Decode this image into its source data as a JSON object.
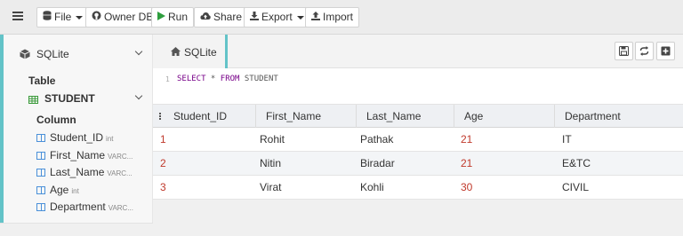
{
  "toolbar": {
    "buttons": [
      {
        "label": "File",
        "icon": "database-icon"
      },
      {
        "label": "Owner DB",
        "icon": "github-icon"
      },
      {
        "label": "Run",
        "icon": "play-icon"
      },
      {
        "label": "Share",
        "icon": "cloud-upload-icon"
      },
      {
        "label": "Export",
        "icon": "download-icon"
      },
      {
        "label": "Import",
        "icon": "upload-icon"
      }
    ],
    "accent_color": "#63c3c8",
    "run_color": "#2e9e3e"
  },
  "sidebar": {
    "db_label": "SQLite",
    "table_heading": "Table",
    "table_name": "STUDENT",
    "column_heading": "Column",
    "columns": [
      {
        "name": "Student_ID",
        "type": "int"
      },
      {
        "name": "First_Name",
        "type": "VARC..."
      },
      {
        "name": "Last_Name",
        "type": "VARC..."
      },
      {
        "name": "Age",
        "type": "int"
      },
      {
        "name": "Department",
        "type": "VARC..."
      }
    ]
  },
  "tab": {
    "label": "SQLite"
  },
  "editor": {
    "line_number": "1",
    "kw1": "SELECT",
    "star": " * ",
    "kw2": "FROM",
    "table": " STUDENT"
  },
  "results": {
    "headers": [
      "Student_ID",
      "First_Name",
      "Last_Name",
      "Age",
      "Department"
    ],
    "rows": [
      [
        "1",
        "Rohit",
        "Pathak",
        "21",
        "IT"
      ],
      [
        "2",
        "Nitin",
        "Biradar",
        "21",
        "E&TC"
      ],
      [
        "3",
        "Virat",
        "Kohli",
        "30",
        "CIVIL"
      ]
    ]
  }
}
